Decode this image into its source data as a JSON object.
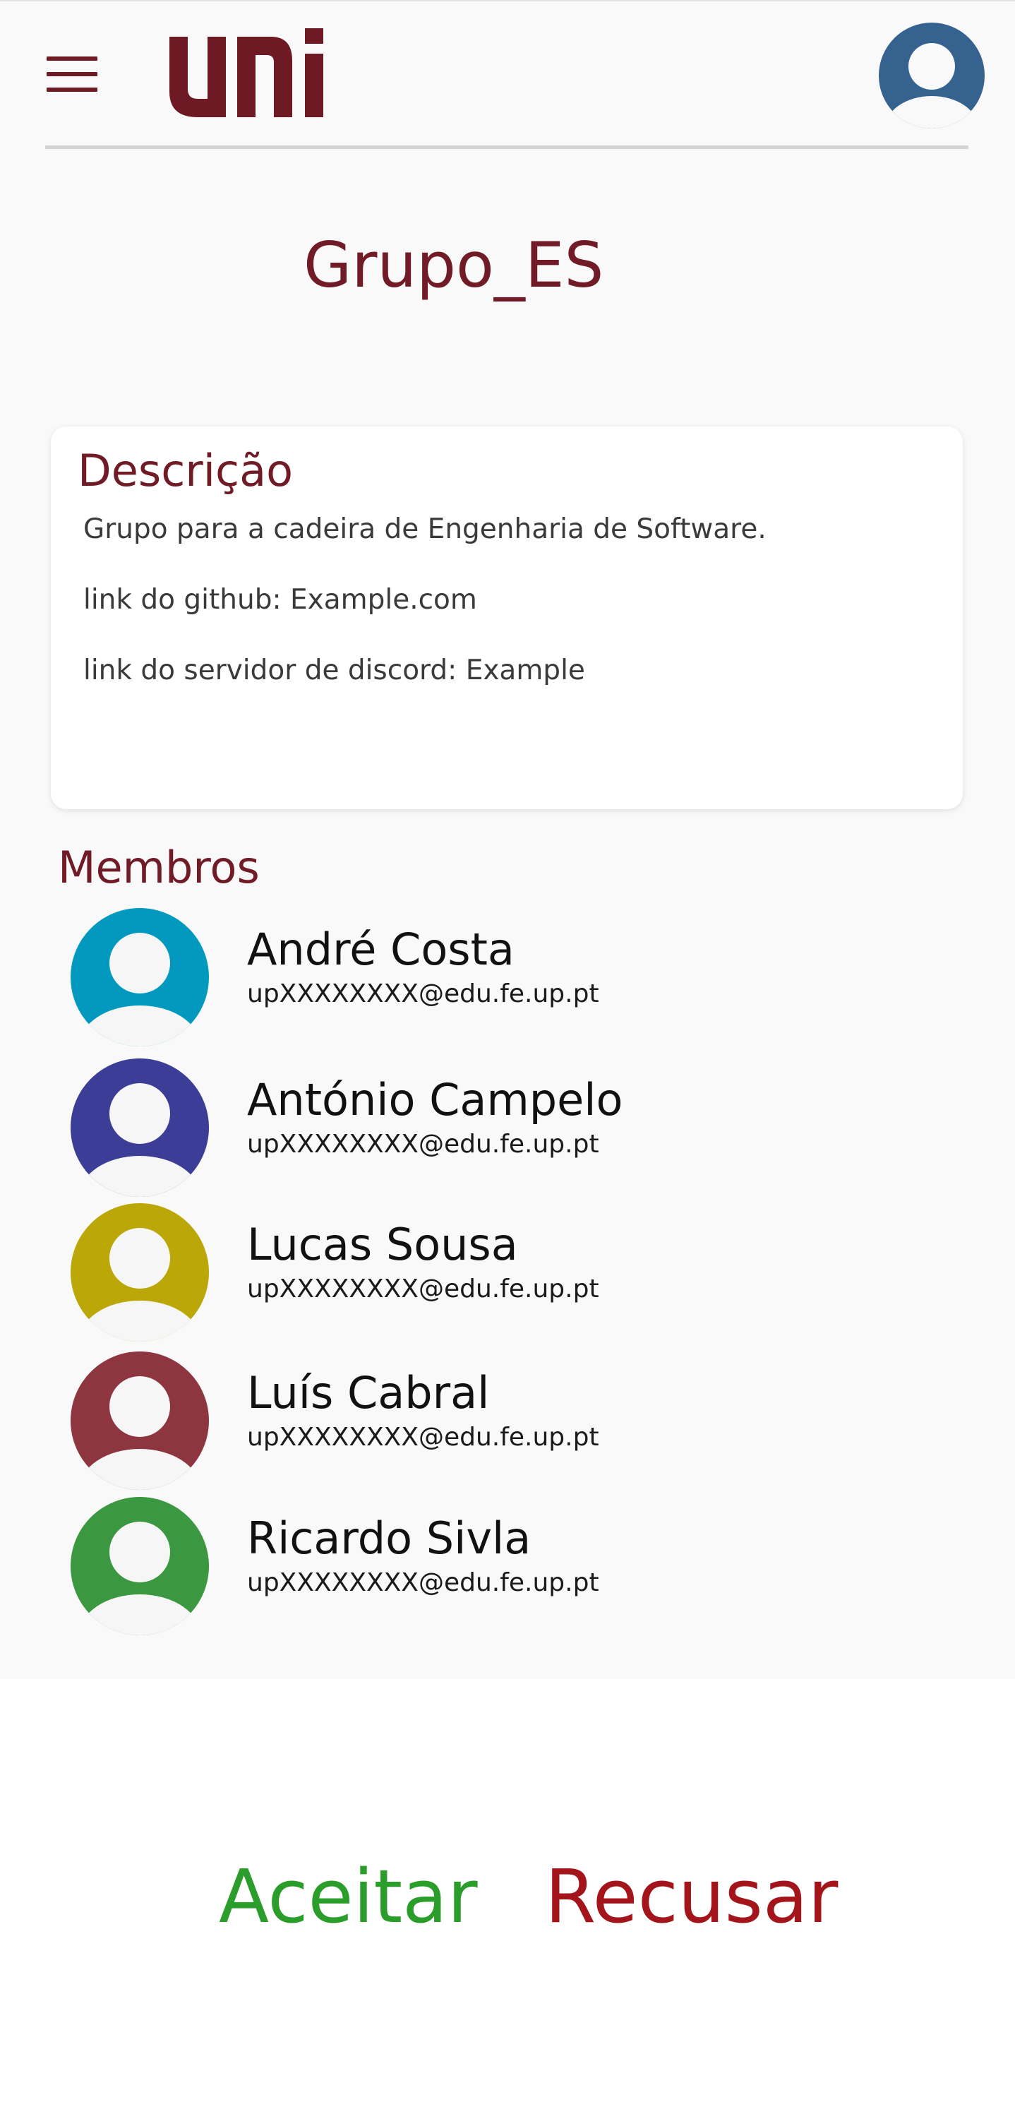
{
  "header": {
    "menu_icon": "hamburger-menu-icon",
    "logo_text": "uni",
    "profile_icon": "user-avatar-icon",
    "profile_color": "#36628f"
  },
  "group": {
    "title": "Grupo_ES"
  },
  "description": {
    "heading": "Descrição",
    "lines": [
      "Grupo para a cadeira de Engenharia de Software.",
      "link do github: Example.com",
      "link do servidor de discord: Example"
    ]
  },
  "members": {
    "heading": "Membros",
    "list": [
      {
        "name": "André Costa",
        "email": "upXXXXXXXX@edu.fe.up.pt",
        "color": "#0399bf"
      },
      {
        "name": "António Campelo",
        "email": "upXXXXXXXX@edu.fe.up.pt",
        "color": "#3b3d97"
      },
      {
        "name": "Lucas Sousa",
        "email": "upXXXXXXXX@edu.fe.up.pt",
        "color": "#bca708"
      },
      {
        "name": "Luís Cabral",
        "email": "upXXXXXXXX@edu.fe.up.pt",
        "color": "#8e3640"
      },
      {
        "name": "Ricardo Sivla",
        "email": "upXXXXXXXX@edu.fe.up.pt",
        "color": "#3b9740"
      }
    ]
  },
  "actions": {
    "accept_label": "Aceitar",
    "reject_label": "Recusar",
    "accept_color": "#2a9d2a",
    "reject_color": "#a3141b"
  }
}
